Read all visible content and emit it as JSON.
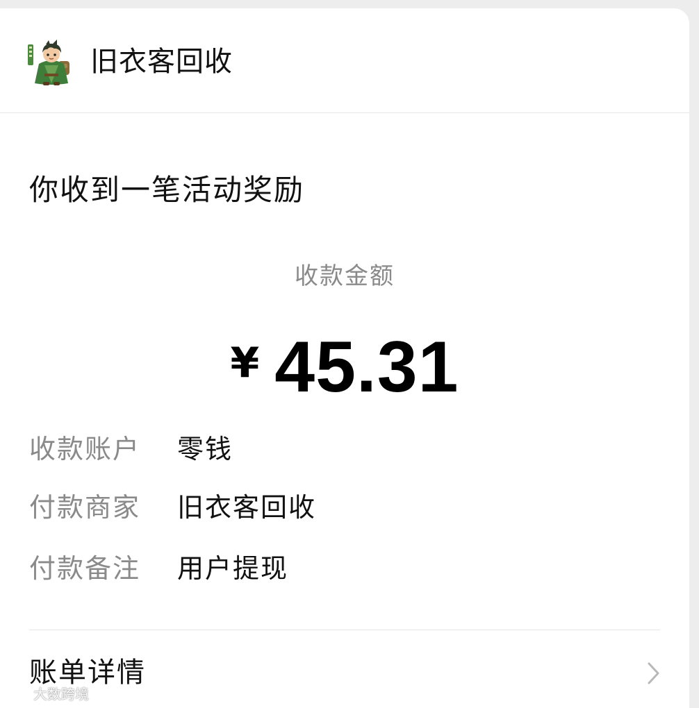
{
  "header": {
    "merchant_name": "旧衣客回收",
    "avatar_icon": "cartoon-boy-avatar-icon"
  },
  "notice": {
    "title": "你收到一笔活动奖励"
  },
  "amount": {
    "label": "收款金额",
    "currency": "¥",
    "value": "45.31"
  },
  "details": [
    {
      "label": "收款账户",
      "value": "零钱"
    },
    {
      "label": "付款商家",
      "value": "旧衣客回收"
    },
    {
      "label": "付款备注",
      "value": "用户提现"
    }
  ],
  "bill": {
    "label": "账单详情",
    "icon": "chevron-right-icon"
  },
  "watermark": {
    "text": "大数跨境"
  },
  "colors": {
    "background": "#ededed",
    "card": "#ffffff",
    "primary_text": "#111111",
    "secondary_text": "#8a8a8a",
    "divider": "#e6e6e6",
    "avatar_green": "#3f7d3a"
  }
}
